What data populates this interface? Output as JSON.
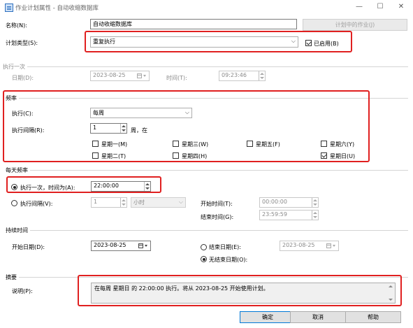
{
  "window": {
    "title": "作业计划属性 - 自动收缩数据库",
    "minimize": "—",
    "maximize": "☐",
    "close": "✕"
  },
  "name": {
    "label": "名称(N):",
    "value": "自动收缩数据库"
  },
  "jobs_button": "计划中的作业(J)",
  "schedule_type": {
    "label": "计划类型(S):",
    "value": "重复执行",
    "enabled_label": "已启用(B)"
  },
  "one_time": {
    "section": "执行一次",
    "date_label": "日期(D):",
    "date_value": "2023-08-25",
    "time_label": "时间(T):",
    "time_value": "09:23:46"
  },
  "frequency": {
    "section": "频率",
    "occurs_label": "执行(C):",
    "occurs_value": "每周",
    "recurs_label": "执行间隔(R):",
    "recurs_value": "1",
    "recurs_unit": "周，在",
    "days": {
      "mon": "星期一(M)",
      "tue": "星期二(T)",
      "wed": "星期三(W)",
      "thu": "星期四(H)",
      "fri": "星期五(F)",
      "sat": "星期六(Y)",
      "sun": "星期日(U)"
    }
  },
  "daily": {
    "section": "每天频率",
    "once_label": "执行一次，时间为(A):",
    "once_value": "22:00:00",
    "every_label": "执行间隔(V):",
    "every_value": "1",
    "every_unit": "小时",
    "start_label": "开始时间(T):",
    "start_value": "00:00:00",
    "end_label": "结束时间(G):",
    "end_value": "23:59:59"
  },
  "duration": {
    "section": "持续时间",
    "start_label": "开始日期(D):",
    "start_value": "2023-08-25",
    "end_label": "结束日期(E):",
    "end_value": "2023-08-25",
    "no_end_label": "无结束日期(O):"
  },
  "summary": {
    "section": "摘要",
    "desc_label": "说明(P):",
    "desc_value": "在每周 星期日 的 22:00:00 执行。将从 2023-08-25 开始使用计划。"
  },
  "buttons": {
    "ok": "确定",
    "cancel": "取消",
    "help": "帮助"
  },
  "colors": {
    "highlight": "#e02020",
    "accent": "#0078d7"
  }
}
